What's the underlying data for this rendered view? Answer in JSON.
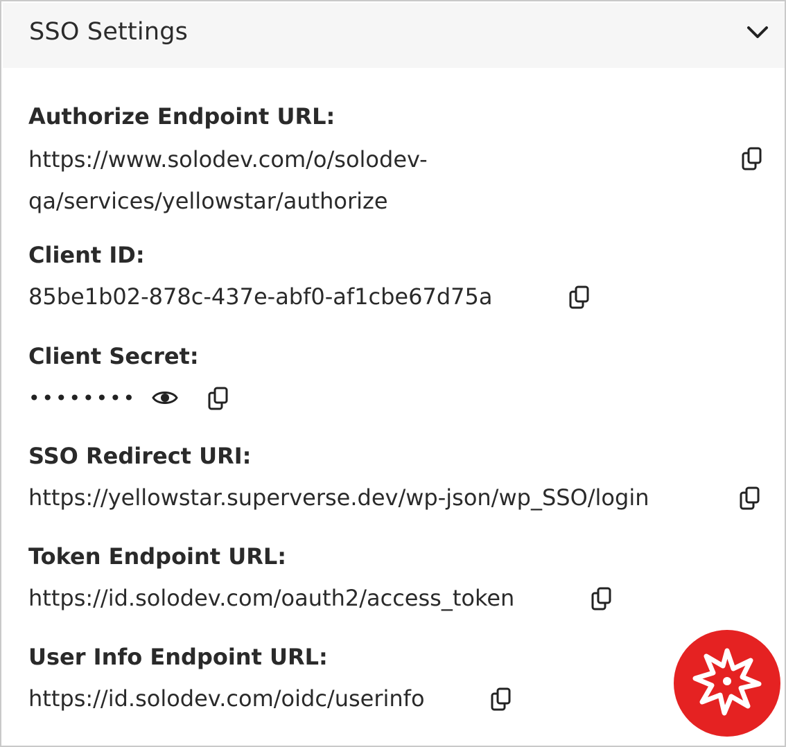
{
  "panel": {
    "title": "SSO Settings",
    "toggle_icon": "chevron-down-icon"
  },
  "fields": {
    "authorize": {
      "label": "Authorize Endpoint URL:",
      "value_line1": "https://www.solodev.com/o/solodev-",
      "value_line2": "qa/services/yellowstar/authorize"
    },
    "client_id": {
      "label": "Client ID:",
      "value": "85be1b02-878c-437e-abf0-af1cbe67d75a"
    },
    "client_secret": {
      "label": "Client Secret:",
      "masked_value": "••••••••"
    },
    "redirect_uri": {
      "label": "SSO Redirect URI:",
      "value": "https://yellowstar.superverse.dev/wp-json/wp_SSO/login"
    },
    "token": {
      "label": "Token Endpoint URL:",
      "value": "https://id.solodev.com/oauth2/access_token"
    },
    "user_info": {
      "label": "User Info Endpoint URL:",
      "value": "https://id.solodev.com/oidc/userinfo"
    }
  },
  "icons": {
    "copy": "copy-icon",
    "reveal": "eye-icon",
    "fab": "solodev-star-logo"
  },
  "colors": {
    "header_bg": "#f6f6f6",
    "text": "#2a2a2a",
    "fab": "#e52222",
    "border": "#c9c9c9"
  }
}
